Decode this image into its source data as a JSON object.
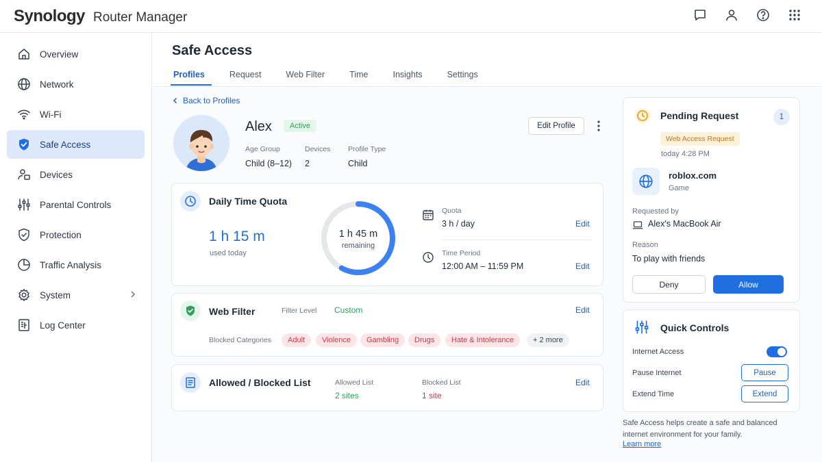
{
  "header": {
    "brand": "Synology",
    "app_name": "Router Manager",
    "icons": [
      "chat-icon",
      "user-icon",
      "help-icon",
      "apps-grid-icon"
    ]
  },
  "sidebar": {
    "items": [
      {
        "label": "Overview",
        "icon": "home-icon"
      },
      {
        "label": "Network",
        "icon": "globe-icon"
      },
      {
        "label": "Wi-Fi",
        "icon": "wifi-icon"
      },
      {
        "label": "Safe Access",
        "icon": "shield-check-icon",
        "active": true
      },
      {
        "label": "Devices",
        "icon": "devices-icon"
      },
      {
        "label": "Parental Controls",
        "icon": "sliders-icon"
      },
      {
        "label": "Protection",
        "icon": "shield-icon"
      },
      {
        "label": "Traffic Analysis",
        "icon": "pie-chart-icon"
      },
      {
        "label": "System",
        "icon": "gear-icon"
      },
      {
        "label": "Log Center",
        "icon": "log-icon"
      }
    ]
  },
  "page": {
    "title": "Safe Access",
    "tabs": [
      "Profiles",
      "Request",
      "Web Filter",
      "Time",
      "Insights",
      "Settings"
    ],
    "active_tab": "Profiles",
    "back_link": "Back to Profiles"
  },
  "profile": {
    "name": "Alex",
    "status": "Active",
    "edit_button": "Edit Profile",
    "age_group_label": "Age Group",
    "age_group": "Child (8–12)",
    "devices_label": "Devices",
    "devices": "2",
    "profile_type_label": "Profile Type",
    "profile_type": "Child"
  },
  "time_quota": {
    "title": "Daily Time Quota",
    "used": "1 h 15 m",
    "used_label": "used today",
    "remaining": "1 h 45 m",
    "remaining_label": "remaining",
    "remaining_fraction": 0.58,
    "quota_label": "Quota",
    "quota_value": "3 h / day",
    "period_label": "Time Period",
    "period_value": "12:00 AM – 11:59 PM",
    "edit": "Edit"
  },
  "web_filter": {
    "title": "Web Filter",
    "level_label": "Filter Level",
    "level_value": "Custom",
    "blocked_label": "Blocked Categories",
    "categories": [
      "Adult",
      "Violence",
      "Gambling",
      "Drugs",
      "Hate & Intolerance"
    ],
    "more": "+ 2 more",
    "edit": "Edit"
  },
  "lists": {
    "title": "Allowed / Blocked List",
    "allowed_label": "Allowed List",
    "allowed_value": "2 sites",
    "blocked_label": "Blocked List",
    "blocked_value": "1 site",
    "edit": "Edit"
  },
  "pending": {
    "title": "Pending Request",
    "count": "1",
    "type": "Web Access Request",
    "time": "today 4:28 PM",
    "site": "roblox.com",
    "category": "Game",
    "requested_by_label": "Requested by",
    "requested_by": "Alex's MacBook Air",
    "reason_label": "Reason",
    "reason": "To play with friends",
    "deny": "Deny",
    "allow": "Allow"
  },
  "quick_controls": {
    "title": "Quick Controls",
    "internet_access": "Internet Access",
    "internet_access_on": true,
    "pause_label": "Pause Internet",
    "pause_button": "Pause",
    "extend_label": "Extend Time",
    "extend_button": "Extend"
  },
  "info": {
    "text": "Safe Access helps create a safe and balanced internet environment for your family.",
    "link": "Learn more"
  },
  "colors": {
    "accent": "#1f6fe0",
    "success": "#2e9e5a",
    "danger": "#c23b48",
    "warning": "#b7791f"
  }
}
